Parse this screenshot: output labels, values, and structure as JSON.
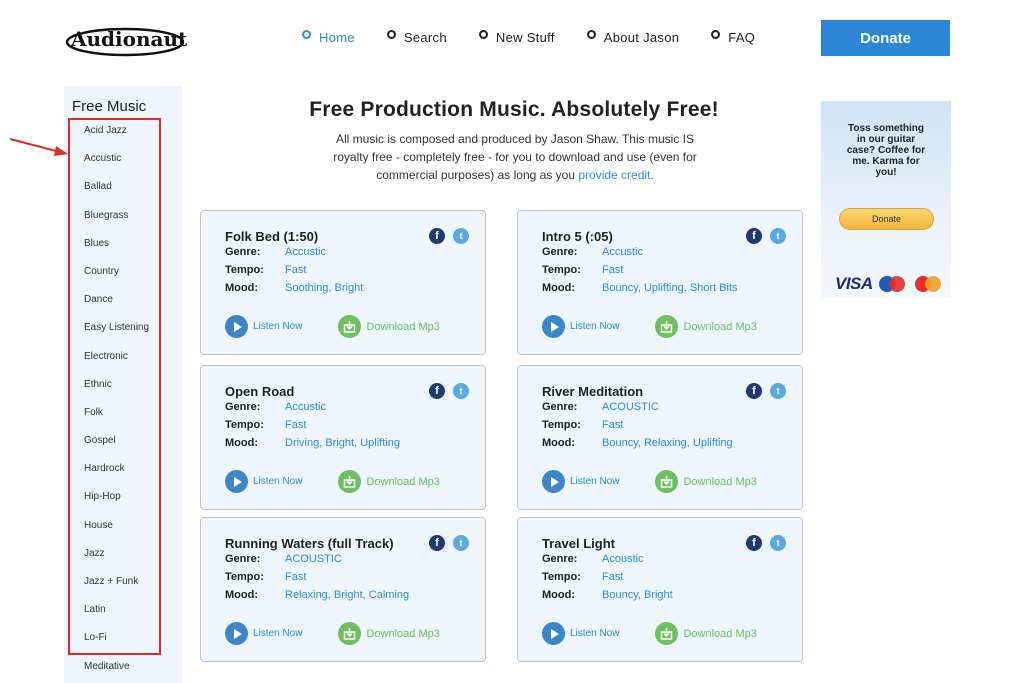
{
  "brand": {
    "logo_text": "Audionautix"
  },
  "nav": {
    "items": [
      {
        "label": "Home",
        "active": true
      },
      {
        "label": "Search",
        "active": false
      },
      {
        "label": "New Stuff",
        "active": false
      },
      {
        "label": "About Jason",
        "active": false
      },
      {
        "label": "FAQ",
        "active": false
      }
    ],
    "donate_label": "Donate"
  },
  "sidebar": {
    "title": "Free Music",
    "genres": [
      "Acid Jazz",
      "Accustic",
      "Ballad",
      "Bluegrass",
      "Blues",
      "Country",
      "Dance",
      "Easy Listening",
      "Electronic",
      "Ethnic",
      "Folk",
      "Gospel",
      "Hardrock",
      "Hip-Hop",
      "House",
      "Jazz",
      "Jazz + Funk",
      "Latin",
      "Lo-Fi",
      "Meditative"
    ]
  },
  "main": {
    "headline": "Free Production Music. Absolutely Free!",
    "intro_text": "All music is composed and produced by Jason Shaw. This music IS royalty free - completely free - for you to download and use (even for commercial purposes) as long as you",
    "intro_link": "provide credit",
    "intro_end": ".",
    "labels": {
      "genre": "Genre:",
      "tempo": "Tempo:",
      "mood": "Mood:",
      "listen": "Listen Now",
      "download": "Download Mp3"
    },
    "tracks": [
      {
        "title": "Folk Bed (1:50)",
        "genre": "Accustic",
        "tempo": "Fast",
        "mood": "Soothing, Bright"
      },
      {
        "title": "Intro 5 (:05)",
        "genre": "Accustic",
        "tempo": "Fast",
        "mood": "Bouncy, Uplifting, Short Bits"
      },
      {
        "title": "Open Road",
        "genre": "Accustic",
        "tempo": "Fast",
        "mood": "Driving, Bright, Uplifting"
      },
      {
        "title": "River Meditation",
        "genre": "ACOUSTIC",
        "tempo": "Fast",
        "mood": "Bouncy, Relaxing, Uplifting"
      },
      {
        "title": "Running Waters (full Track)",
        "genre": "ACOUSTIC",
        "tempo": "Fast",
        "mood": "Relaxing, Bright, Calming"
      },
      {
        "title": "Travel Light",
        "genre": "Acoustic",
        "tempo": "Fast",
        "mood": "Bouncy, Bright"
      }
    ]
  },
  "ad": {
    "text": "Toss something in our guitar case? Coffee for me. Karma for you!",
    "button": "Donate",
    "card_brands": [
      "VISA",
      "Maestro",
      "MasterCard"
    ]
  },
  "colors": {
    "accent": "#2a8fd6",
    "donate": "#2b86d6",
    "download": "#6cc060",
    "annotation": "#e02a2a"
  }
}
